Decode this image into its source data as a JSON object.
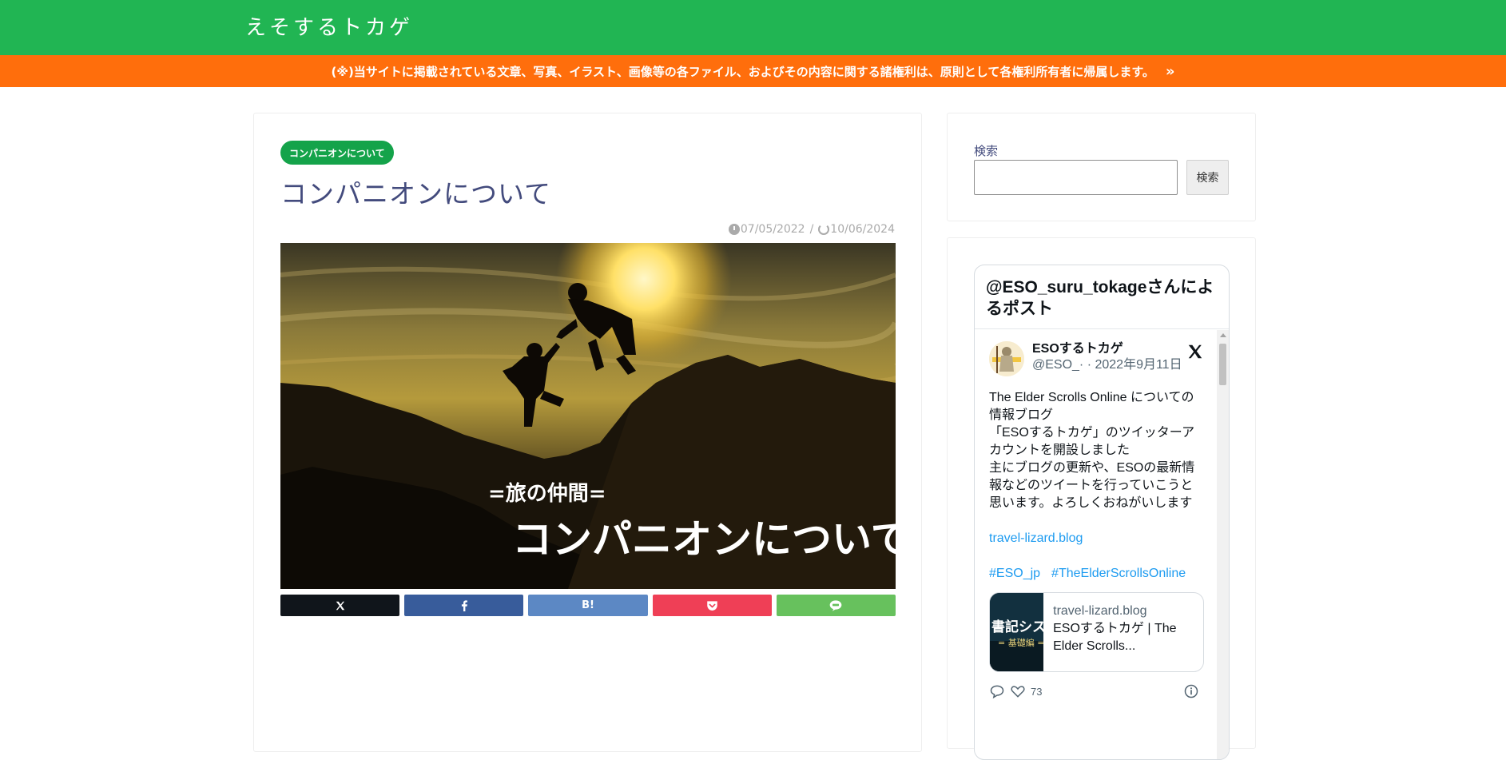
{
  "header": {
    "site_title": "えそするトカゲ"
  },
  "notice": {
    "text": "(※)当サイトに掲載されている文章、写真、イラスト、画像等の各ファイル、およびその内容に関する諸権利は、原則として各権利所有者に帰属します。",
    "chevron": "»"
  },
  "article": {
    "category": "コンパニオンについて",
    "title": "コンパニオンについて",
    "published": "07/05/2022",
    "separator": "/",
    "updated": "10/06/2024",
    "eyecatch": {
      "subtitle": "=旅の仲間=",
      "title": "コンパニオンについて"
    },
    "share": {
      "x_icon": "x-logo-icon",
      "facebook_icon": "facebook-icon",
      "hatena_label": "B!",
      "pocket_icon": "pocket-icon",
      "line_icon": "line-icon"
    }
  },
  "sidebar": {
    "search": {
      "label": "検索",
      "button": "検索",
      "value": ""
    },
    "timeline": {
      "header": "@ESO_suru_tokageさんによるポスト",
      "tweet": {
        "author_name": "ESOするトカゲ",
        "author_meta": "@ESO_· · 2022年9月11日",
        "text": "The Elder Scrolls Online についての情報ブログ\n「ESOするトカゲ」のツイッターアカウントを開設しました\n主にブログの更新や、ESOの最新情報などのツイートを行っていこうと思います。よろしくおねがいします",
        "link": "travel-lizard.blog",
        "tags": [
          "#ESO_jp",
          "#TheElderScrollsOnline"
        ],
        "card": {
          "domain": "travel-lizard.blog",
          "title": "ESOするトカゲ | The Elder Scrolls...",
          "thumb_text": "書記システ",
          "thumb_sub": "= 基礎編 ="
        },
        "likes": "73"
      }
    }
  },
  "colors": {
    "header_green": "#21b553",
    "notice_orange": "#ff6e0c",
    "badge_green": "#14a34a",
    "title_navy": "#434b7d",
    "link_blue": "#1d9bf0"
  }
}
